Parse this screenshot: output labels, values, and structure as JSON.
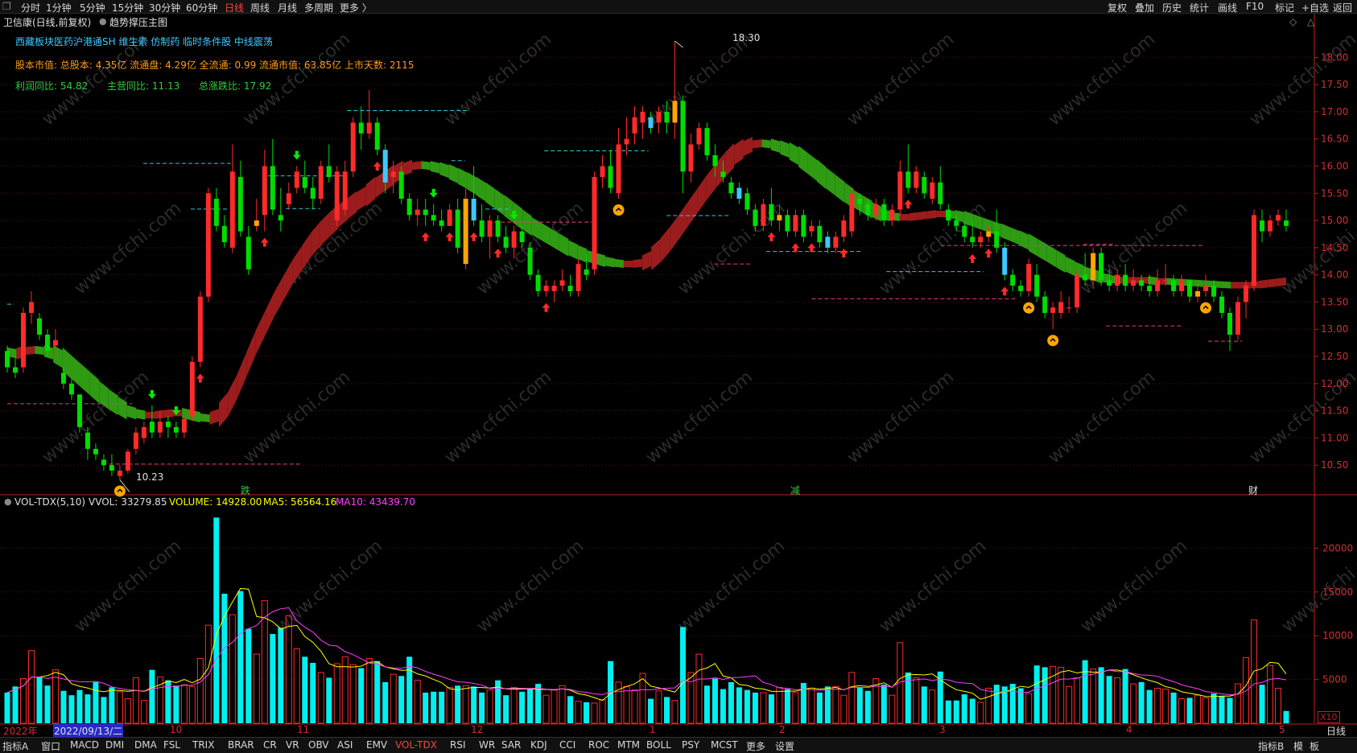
{
  "toolbar": {
    "left": [
      "分时",
      "1分钟",
      "5分钟",
      "15分钟",
      "30分钟",
      "60分钟",
      "日线",
      "周线",
      "月线",
      "多周期",
      "更多 〉"
    ],
    "active": "日线",
    "right": [
      "复权",
      "叠加",
      "历史",
      "统计",
      "画线",
      "F10",
      "标记",
      "+自选",
      "返回"
    ]
  },
  "header": {
    "title": "卫信康(日线,前复权)",
    "indicator": "趋势撑压主图",
    "concepts": "西藏板块医药沪港通SH 维生素 仿制药 临时条件股 中线震荡",
    "capital": "股本市值: 总股本: 4.35亿 流通盘: 4.29亿 全流通: 0.99 流通市值: 63.85亿 上市天数: 2115",
    "profit": "利润同比: 54.82",
    "revenue": "主营同比: 11.13",
    "change": "总涨跌比: 17.92"
  },
  "annotations": {
    "high": "18.30",
    "low": "10.23",
    "mark_die": "跌",
    "mark_jian": "减",
    "mark_cai": "财"
  },
  "volume_panel": {
    "name": "VOL-TDX(5,10)",
    "vvol": "VVOL: 33279.85",
    "volume": "VOLUME: 14928.00",
    "ma5": "MA5: 56564.16",
    "ma10": "MA10: 43439.70",
    "unit": "X10",
    "period": "日线"
  },
  "time_axis": {
    "year": "2022年",
    "cursor_date": "2022/09/13/二",
    "months": [
      "10",
      "11",
      "12",
      "1",
      "2",
      "3",
      "4",
      "5"
    ]
  },
  "bottom_tabs": [
    "指标A",
    "窗口",
    "MACD",
    "DMI",
    "DMA",
    "FSL",
    "TRIX",
    "BRAR",
    "CR",
    "VR",
    "OBV",
    "ASI",
    "EMV",
    "VOL-TDX",
    "RSI",
    "WR",
    "SAR",
    "KDJ",
    "CCI",
    "ROC",
    "MTM",
    "BOLL",
    "PSY",
    "MCST",
    "更多",
    "设置"
  ],
  "bottom_active": "VOL-TDX",
  "bottom_right": [
    "指标B",
    "模",
    "板"
  ],
  "colors": {
    "up": "#ff2a2a",
    "down": "#00dd00",
    "vol_down": "#00f0f0",
    "ma5": "#ffff00",
    "ma10": "#ff40ff",
    "band_up": "#9b1c1c",
    "band_down": "#2e9b12",
    "axis": "#c02020",
    "support": "#e0407a",
    "resist": "#2ec8d8"
  },
  "chart_data": {
    "type": "candlestick",
    "price_axis": [
      10.5,
      11.0,
      11.5,
      12.0,
      12.5,
      13.0,
      13.5,
      14.0,
      14.5,
      15.0,
      15.5,
      16.0,
      16.5,
      17.0,
      17.5,
      18.0
    ],
    "price_range": [
      10.0,
      18.7
    ],
    "volume_axis": [
      5000,
      10000,
      15000,
      20000
    ],
    "volume_range": [
      0,
      25000
    ],
    "ohlc": [
      [
        12.6,
        12.7,
        12.2,
        12.3
      ],
      [
        12.3,
        12.5,
        12.1,
        12.2
      ],
      [
        12.3,
        13.4,
        12.2,
        13.3
      ],
      [
        13.3,
        13.7,
        13.1,
        13.5
      ],
      [
        13.2,
        13.3,
        12.8,
        12.9
      ],
      [
        12.9,
        13.0,
        12.5,
        12.6
      ],
      [
        12.7,
        13.0,
        12.5,
        12.8
      ],
      [
        12.2,
        12.3,
        11.9,
        12.0
      ],
      [
        12.0,
        12.1,
        11.7,
        11.8
      ],
      [
        11.8,
        11.8,
        11.1,
        11.2
      ],
      [
        11.1,
        11.2,
        10.6,
        10.8
      ],
      [
        10.8,
        10.9,
        10.6,
        10.7
      ],
      [
        10.6,
        10.7,
        10.4,
        10.5
      ],
      [
        10.5,
        10.7,
        10.3,
        10.4
      ],
      [
        10.3,
        10.5,
        10.23,
        10.4
      ],
      [
        10.4,
        10.8,
        10.35,
        10.75
      ],
      [
        10.8,
        11.2,
        10.7,
        11.1
      ],
      [
        11.0,
        11.3,
        10.9,
        11.2
      ],
      [
        11.3,
        11.6,
        11.0,
        11.1
      ],
      [
        11.1,
        11.5,
        11.0,
        11.3
      ],
      [
        11.3,
        11.4,
        11.0,
        11.2
      ],
      [
        11.2,
        11.3,
        11.0,
        11.1
      ],
      [
        11.1,
        11.4,
        11.0,
        11.35
      ],
      [
        11.4,
        12.5,
        11.3,
        12.4
      ],
      [
        12.4,
        13.7,
        12.3,
        13.6
      ],
      [
        13.6,
        15.6,
        13.5,
        15.5
      ],
      [
        15.4,
        15.6,
        14.8,
        14.9
      ],
      [
        14.9,
        15.1,
        14.5,
        14.6
      ],
      [
        14.5,
        16.4,
        14.4,
        15.9
      ],
      [
        15.8,
        16.1,
        14.7,
        14.8
      ],
      [
        14.7,
        14.9,
        14.0,
        14.1
      ],
      [
        14.9,
        15.4,
        14.8,
        15.0
      ],
      [
        15.1,
        16.3,
        14.8,
        16.0
      ],
      [
        16.0,
        16.5,
        15.1,
        15.2
      ],
      [
        15.1,
        15.6,
        14.8,
        15.0
      ],
      [
        15.3,
        15.7,
        15.2,
        15.5
      ],
      [
        15.6,
        16.0,
        15.5,
        15.9
      ],
      [
        15.8,
        16.1,
        15.5,
        15.6
      ],
      [
        15.6,
        15.8,
        15.2,
        15.4
      ],
      [
        15.4,
        16.1,
        15.3,
        16.0
      ],
      [
        16.0,
        16.4,
        15.7,
        15.8
      ],
      [
        15.0,
        16.0,
        14.9,
        15.9
      ],
      [
        15.2,
        16.1,
        15.1,
        15.9
      ],
      [
        15.9,
        16.9,
        15.8,
        16.8
      ],
      [
        16.8,
        17.1,
        16.3,
        16.6
      ],
      [
        16.6,
        17.4,
        16.5,
        16.8
      ],
      [
        16.8,
        16.9,
        16.2,
        16.3
      ],
      [
        16.3,
        16.4,
        15.5,
        15.7
      ],
      [
        15.8,
        16.1,
        15.5,
        15.9
      ],
      [
        15.9,
        16.0,
        15.3,
        15.4
      ],
      [
        15.4,
        15.5,
        15.0,
        15.1
      ],
      [
        15.1,
        15.4,
        14.9,
        15.2
      ],
      [
        15.2,
        15.4,
        14.9,
        15.1
      ],
      [
        15.1,
        15.3,
        14.9,
        15.0
      ],
      [
        15.0,
        15.2,
        14.8,
        14.9
      ],
      [
        14.9,
        15.3,
        14.9,
        15.2
      ],
      [
        15.2,
        15.4,
        14.4,
        14.5
      ],
      [
        14.2,
        15.6,
        14.1,
        15.4
      ],
      [
        15.4,
        16.0,
        14.9,
        15.0
      ],
      [
        15.0,
        15.3,
        14.6,
        14.7
      ],
      [
        14.7,
        15.1,
        14.3,
        15.0
      ],
      [
        15.0,
        15.1,
        14.6,
        14.7
      ],
      [
        14.7,
        14.9,
        14.4,
        14.5
      ],
      [
        14.5,
        14.9,
        14.3,
        14.8
      ],
      [
        14.8,
        14.9,
        14.5,
        14.6
      ],
      [
        14.5,
        14.6,
        13.9,
        14.0
      ],
      [
        14.0,
        14.1,
        13.6,
        13.7
      ],
      [
        13.7,
        13.9,
        13.6,
        13.8
      ],
      [
        13.7,
        13.9,
        13.5,
        13.8
      ],
      [
        13.8,
        14.1,
        13.7,
        13.9
      ],
      [
        13.8,
        14.0,
        13.6,
        13.7
      ],
      [
        13.7,
        14.3,
        13.6,
        14.2
      ],
      [
        14.1,
        14.4,
        13.9,
        14.0
      ],
      [
        14.1,
        15.9,
        14.0,
        15.8
      ],
      [
        15.8,
        16.2,
        15.6,
        16.0
      ],
      [
        16.0,
        16.3,
        15.5,
        15.6
      ],
      [
        15.5,
        16.7,
        15.4,
        16.4
      ],
      [
        16.4,
        16.9,
        16.2,
        16.5
      ],
      [
        16.6,
        17.1,
        16.4,
        16.9
      ],
      [
        16.8,
        17.1,
        16.5,
        17.0
      ],
      [
        16.9,
        17.0,
        16.6,
        16.7
      ],
      [
        16.8,
        17.1,
        16.6,
        17.0
      ],
      [
        17.0,
        17.2,
        16.6,
        16.8
      ],
      [
        16.8,
        18.3,
        16.5,
        17.2
      ],
      [
        17.2,
        17.3,
        15.5,
        15.9
      ],
      [
        15.9,
        16.6,
        15.7,
        16.4
      ],
      [
        16.4,
        16.8,
        16.3,
        16.7
      ],
      [
        16.7,
        16.8,
        16.1,
        16.2
      ],
      [
        16.2,
        16.4,
        15.8,
        16.0
      ],
      [
        15.9,
        16.1,
        15.7,
        15.8
      ],
      [
        15.7,
        15.8,
        15.4,
        15.5
      ],
      [
        15.6,
        15.7,
        15.3,
        15.4
      ],
      [
        15.5,
        15.6,
        15.1,
        15.2
      ],
      [
        15.2,
        15.3,
        14.8,
        14.9
      ],
      [
        14.9,
        15.4,
        14.8,
        15.3
      ],
      [
        15.3,
        15.6,
        14.9,
        15.0
      ],
      [
        15.0,
        15.3,
        14.8,
        15.1
      ],
      [
        15.1,
        15.2,
        14.7,
        14.8
      ],
      [
        14.8,
        15.2,
        14.7,
        15.1
      ],
      [
        15.1,
        15.2,
        14.6,
        14.7
      ],
      [
        14.8,
        15.0,
        14.7,
        14.9
      ],
      [
        14.9,
        15.0,
        14.5,
        14.6
      ],
      [
        14.7,
        14.8,
        14.4,
        14.5
      ],
      [
        14.5,
        14.8,
        14.4,
        14.7
      ],
      [
        14.7,
        15.1,
        14.6,
        15.0
      ],
      [
        14.8,
        15.6,
        14.7,
        15.5
      ],
      [
        15.4,
        15.5,
        15.1,
        15.3
      ],
      [
        15.3,
        15.4,
        15.0,
        15.1
      ],
      [
        15.1,
        15.4,
        15.0,
        15.3
      ],
      [
        15.3,
        15.4,
        14.9,
        15.0
      ],
      [
        15.0,
        15.3,
        14.9,
        15.2
      ],
      [
        15.2,
        16.1,
        15.1,
        15.9
      ],
      [
        15.9,
        16.4,
        15.5,
        15.6
      ],
      [
        15.6,
        16.0,
        15.5,
        15.9
      ],
      [
        15.8,
        15.9,
        15.4,
        15.5
      ],
      [
        15.4,
        15.8,
        15.3,
        15.7
      ],
      [
        15.7,
        16.0,
        15.2,
        15.3
      ],
      [
        15.2,
        15.3,
        14.9,
        15.0
      ],
      [
        15.0,
        15.1,
        14.8,
        14.9
      ],
      [
        14.9,
        15.0,
        14.6,
        14.7
      ],
      [
        14.7,
        15.0,
        14.5,
        14.6
      ],
      [
        14.6,
        14.8,
        14.5,
        14.7
      ],
      [
        14.7,
        14.9,
        14.6,
        14.8
      ],
      [
        14.8,
        15.2,
        14.4,
        14.5
      ],
      [
        14.5,
        14.6,
        13.9,
        14.0
      ],
      [
        14.0,
        14.1,
        13.7,
        13.8
      ],
      [
        13.8,
        13.9,
        13.6,
        13.7
      ],
      [
        13.7,
        14.3,
        13.6,
        14.2
      ],
      [
        14.0,
        14.2,
        13.5,
        13.6
      ],
      [
        13.6,
        13.7,
        13.2,
        13.3
      ],
      [
        13.3,
        13.5,
        13.0,
        13.4
      ],
      [
        13.3,
        13.7,
        13.2,
        13.5
      ],
      [
        13.4,
        13.6,
        13.3,
        13.4
      ],
      [
        13.4,
        14.1,
        13.3,
        14.0
      ],
      [
        14.0,
        14.4,
        13.8,
        13.9
      ],
      [
        13.9,
        14.5,
        13.8,
        14.4
      ],
      [
        14.4,
        14.5,
        13.8,
        13.9
      ],
      [
        13.9,
        14.1,
        13.7,
        13.8
      ],
      [
        13.8,
        14.1,
        13.7,
        14.0
      ],
      [
        14.0,
        14.2,
        13.7,
        13.8
      ],
      [
        13.8,
        14.1,
        13.7,
        13.9
      ],
      [
        13.9,
        14.0,
        13.7,
        13.8
      ],
      [
        13.8,
        14.0,
        13.6,
        13.7
      ],
      [
        13.7,
        14.1,
        13.6,
        13.9
      ],
      [
        13.9,
        14.2,
        13.8,
        13.9
      ],
      [
        13.9,
        14.0,
        13.6,
        13.7
      ],
      [
        13.7,
        14.0,
        13.6,
        13.9
      ],
      [
        13.9,
        13.9,
        13.5,
        13.6
      ],
      [
        13.6,
        13.8,
        13.5,
        13.7
      ],
      [
        13.7,
        14.0,
        13.6,
        13.8
      ],
      [
        13.8,
        13.9,
        13.5,
        13.6
      ],
      [
        13.6,
        13.7,
        13.2,
        13.3
      ],
      [
        13.3,
        13.4,
        12.6,
        12.9
      ],
      [
        12.9,
        13.6,
        12.8,
        13.5
      ],
      [
        13.5,
        13.9,
        13.2,
        13.8
      ],
      [
        13.8,
        15.2,
        13.7,
        15.1
      ],
      [
        15.0,
        15.2,
        14.6,
        14.8
      ],
      [
        14.8,
        15.1,
        14.7,
        15.0
      ],
      [
        15.0,
        15.2,
        14.9,
        15.1
      ],
      [
        15.0,
        15.2,
        14.8,
        14.9
      ]
    ],
    "volume": [
      3500,
      4200,
      5100,
      8300,
      5300,
      4300,
      6100,
      3700,
      3200,
      3800,
      3300,
      4700,
      3000,
      4100,
      3600,
      2800,
      5200,
      2600,
      6100,
      5300,
      4900,
      4300,
      4400,
      4200,
      7400,
      11200,
      23500,
      14800,
      12400,
      15100,
      10800,
      7900,
      14000,
      10200,
      10900,
      12300,
      8500,
      7600,
      6900,
      5800,
      5200,
      6800,
      7600,
      6700,
      6300,
      7400,
      7100,
      4700,
      5600,
      5400,
      7600,
      4900,
      3500,
      3600,
      3600,
      4100,
      4300,
      4300,
      4200,
      3500,
      3800,
      4900,
      3200,
      4100,
      3600,
      3900,
      4500,
      3200,
      3800,
      4300,
      3100,
      2500,
      2400,
      2300,
      2700,
      7100,
      4700,
      4200,
      3800,
      5700,
      2800,
      3700,
      3000,
      2600,
      11000,
      5800,
      7900,
      4300,
      5100,
      3900,
      4700,
      4100,
      3800,
      3500,
      3500,
      3300,
      4100,
      3900,
      3500,
      4600,
      4000,
      3500,
      4200,
      4200,
      3200,
      5800,
      4100,
      3700,
      5100,
      4400,
      3200,
      9200,
      5800,
      5200,
      4200,
      3800,
      5900,
      2600,
      2600,
      3300,
      2800,
      2400,
      4000,
      4400,
      4200,
      4500,
      4000,
      3400,
      6600,
      6400,
      6500,
      6400,
      4200,
      5200,
      7200,
      6200,
      6400,
      5400,
      5200,
      6200,
      4500,
      4700,
      3800,
      4000,
      3900,
      3500,
      2800,
      2900,
      3200,
      2900,
      3400,
      3100,
      2900,
      4500,
      7500,
      11800,
      4400,
      6600,
      4000,
      1400
    ],
    "band_center": [
      12.58,
      12.55,
      12.6,
      12.62,
      12.6,
      12.55,
      12.45,
      12.3,
      12.15,
      12.0,
      11.85,
      11.72,
      11.6,
      11.5,
      11.45,
      11.42,
      11.42,
      11.44,
      11.46,
      11.46,
      11.42,
      11.38,
      11.36,
      11.42,
      11.62,
      11.95,
      12.35,
      12.75,
      13.1,
      13.45,
      13.75,
      14.05,
      14.3,
      14.55,
      14.75,
      14.92,
      15.08,
      15.22,
      15.35,
      15.46,
      15.6,
      15.72,
      15.84,
      15.94,
      16.0,
      16.02,
      16.0,
      15.96,
      15.9,
      15.82,
      15.73,
      15.63,
      15.52,
      15.4,
      15.28,
      15.15,
      15.02,
      14.9,
      14.8,
      14.7,
      14.6,
      14.5,
      14.42,
      14.35,
      14.3,
      14.25,
      14.22,
      14.2,
      14.2,
      14.22,
      14.3,
      14.45,
      14.65,
      14.88,
      15.12,
      15.36,
      15.6,
      15.82,
      16.02,
      16.2,
      16.32,
      16.4,
      16.42,
      16.4,
      16.35,
      16.28,
      16.18,
      16.05,
      15.92,
      15.78,
      15.65,
      15.52,
      15.4,
      15.3,
      15.2,
      15.12,
      15.08,
      15.06,
      15.06,
      15.08,
      15.1,
      15.12,
      15.12,
      15.1,
      15.06,
      15.0,
      14.94,
      14.88,
      14.82,
      14.75,
      14.68,
      14.6,
      14.5,
      14.4,
      14.3,
      14.2,
      14.12,
      14.05,
      14.0,
      13.95,
      13.92,
      13.9,
      13.9,
      13.9,
      13.9,
      13.88,
      13.88,
      13.87,
      13.86,
      13.85,
      13.84,
      13.83,
      13.82,
      13.81,
      13.81,
      13.81,
      13.82,
      13.84,
      13.86,
      13.88
    ],
    "resistance": [
      [
        0,
        3,
        13.46
      ],
      [
        60,
        100,
        16.05
      ],
      [
        81,
        98,
        15.21
      ],
      [
        115,
        148,
        15.82
      ],
      [
        123,
        138,
        15.22
      ],
      [
        150,
        203,
        17.02
      ],
      [
        196,
        202,
        16.1
      ],
      [
        211,
        222,
        15.21
      ],
      [
        237,
        283,
        16.28
      ],
      [
        291,
        319,
        15.09
      ],
      [
        335,
        377,
        14.43
      ],
      [
        388,
        431,
        14.06
      ]
    ],
    "support": [
      [
        0,
        55,
        11.63
      ],
      [
        45,
        130,
        10.52
      ],
      [
        215,
        258,
        14.97
      ],
      [
        312,
        328,
        14.2
      ],
      [
        355,
        445,
        13.56
      ],
      [
        412,
        528,
        14.54
      ],
      [
        475,
        488,
        14.56
      ],
      [
        485,
        518,
        13.06
      ],
      [
        530,
        545,
        12.78
      ]
    ],
    "up_arrows_idx": [
      24,
      32,
      46,
      52,
      55,
      58,
      61,
      67,
      76,
      95,
      98,
      100,
      104,
      112,
      120,
      122,
      124
    ],
    "down_arrows_idx": [
      18,
      21,
      36,
      53,
      63
    ],
    "buy_marks_idx": [
      14,
      76,
      127,
      130,
      149
    ]
  }
}
